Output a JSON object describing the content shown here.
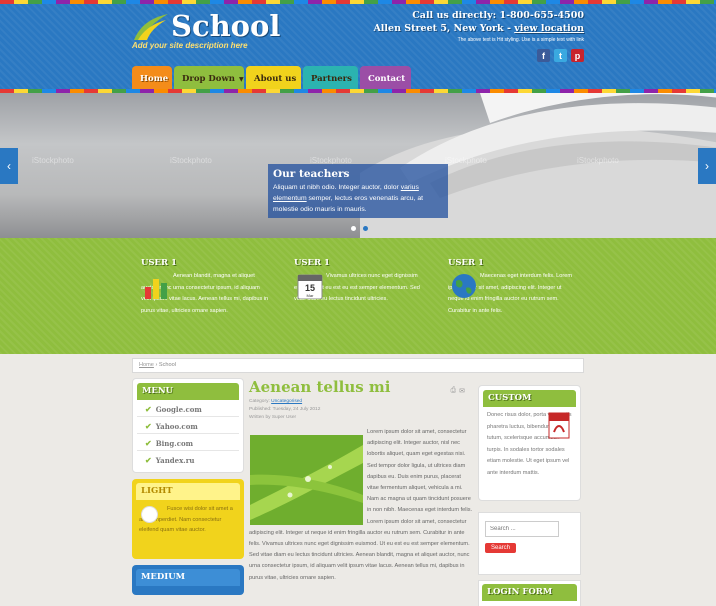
{
  "brand": {
    "name": "School",
    "tagline": "Add your site description here"
  },
  "contact": {
    "phone": "Call us directly: 1-800-655-4500",
    "address": "Allen Street 5, New York -",
    "location_link": "view location",
    "note": "The above text is Hit styling. Use is a simple text with link"
  },
  "social": [
    "facebook-icon",
    "twitter-icon",
    "pinterest-icon"
  ],
  "nav": {
    "home": "Home",
    "dropdown": "Drop Down",
    "about": "About us",
    "partners": "Partners",
    "contact": "Contact"
  },
  "slider": {
    "watermark": "iStockphoto",
    "title": "Our teachers",
    "text_before": "Aliquam ut nibh odio. Integer auctor, dolor ",
    "text_link": "varius elementum",
    "text_after": " semper, lectus eros venenatis arcu, at molestie odio mauris in mauris.",
    "active_slide": 2
  },
  "users": [
    {
      "title": "USER 1",
      "text": "Aenean blandit, magna et aliquet auctor, nunc urna consectetur ipsum, id aliquam velit ipsum vitae lacus. Aenean tellus mi, dapibus in purus vitae, ultricies ornare sapien."
    },
    {
      "title": "USER 1",
      "text": "Vivamus ultrices nunc eget dignissim euismod. Ut eu est eu est semper elementum. Sed vitae diam eu lectus tincidunt ultricies."
    },
    {
      "title": "USER 1",
      "text": "Maecenas eget interdum felis. Lorem ipsum dolor sit amet, adipiscing elit. Integer ut neque id enim fringilla auctor eu rutrum sem. Curabitur in ante felis."
    }
  ],
  "breadcrumb": {
    "home": "Home",
    "current": "School"
  },
  "menu": {
    "title": "MENU",
    "items": [
      "Google.com",
      "Yahoo.com",
      "Bing.com",
      "Yandex.ru"
    ]
  },
  "light": {
    "title": "LIGHT",
    "text": "Fusce wisi dolor sit amet a amet imperdiet. Nam consectetur eleifend quam vitae auctor."
  },
  "medium": {
    "title": "MEDIUM"
  },
  "article": {
    "title": "Aenean tellus mi",
    "category_label": "Category: ",
    "category": "Uncategorised",
    "published": "Published: Tuesday, 24 July 2012",
    "author": "Written by Super User",
    "body": "Lorem ipsum dolor sit amet, consectetur adipiscing elit. Integer auctor, nisl nec lobortis aliquet, quam eget egestas nisi. Sed tempor dolor ligula, ut ultrices diam dapibus eu. Duis enim purus, placerat vitae fermentum aliquet, vehicula a mi. Nam ac magna ut quam tincidunt posuere in non nibh. Maecenas eget interdum felis. Lorem ipsum dolor sit amet, consectetur adipiscing elit. Integer ut neque id enim fringilla auctor eu rutrum sem. Curabitur in ante felis. Vivamus ultrices nunc eget dignissim euismod. Ut eu est eu est semper elementum. Sed vitae diam eu lectus tincidunt ultricies. Aenean blandit, magna et aliquet auctor, nunc urna consectetur ipsum, id aliquam velit ipsum vitae lacus. Aenean tellus mi, dapibus in purus vitae, ultricies ornare sapien."
  },
  "custom": {
    "title": "CUSTOM",
    "text": "Donec risus dolor, porta venenatis pharetra luctus, bibendum vitae tutum, scelerisque accumsan turpis. In sodales tortor sodales etiam molestie. Ut eget ipsum vel ante interdum mattis."
  },
  "search": {
    "placeholder": "Search ...",
    "button": "Search"
  },
  "login": {
    "title": "LOGIN FORM"
  }
}
